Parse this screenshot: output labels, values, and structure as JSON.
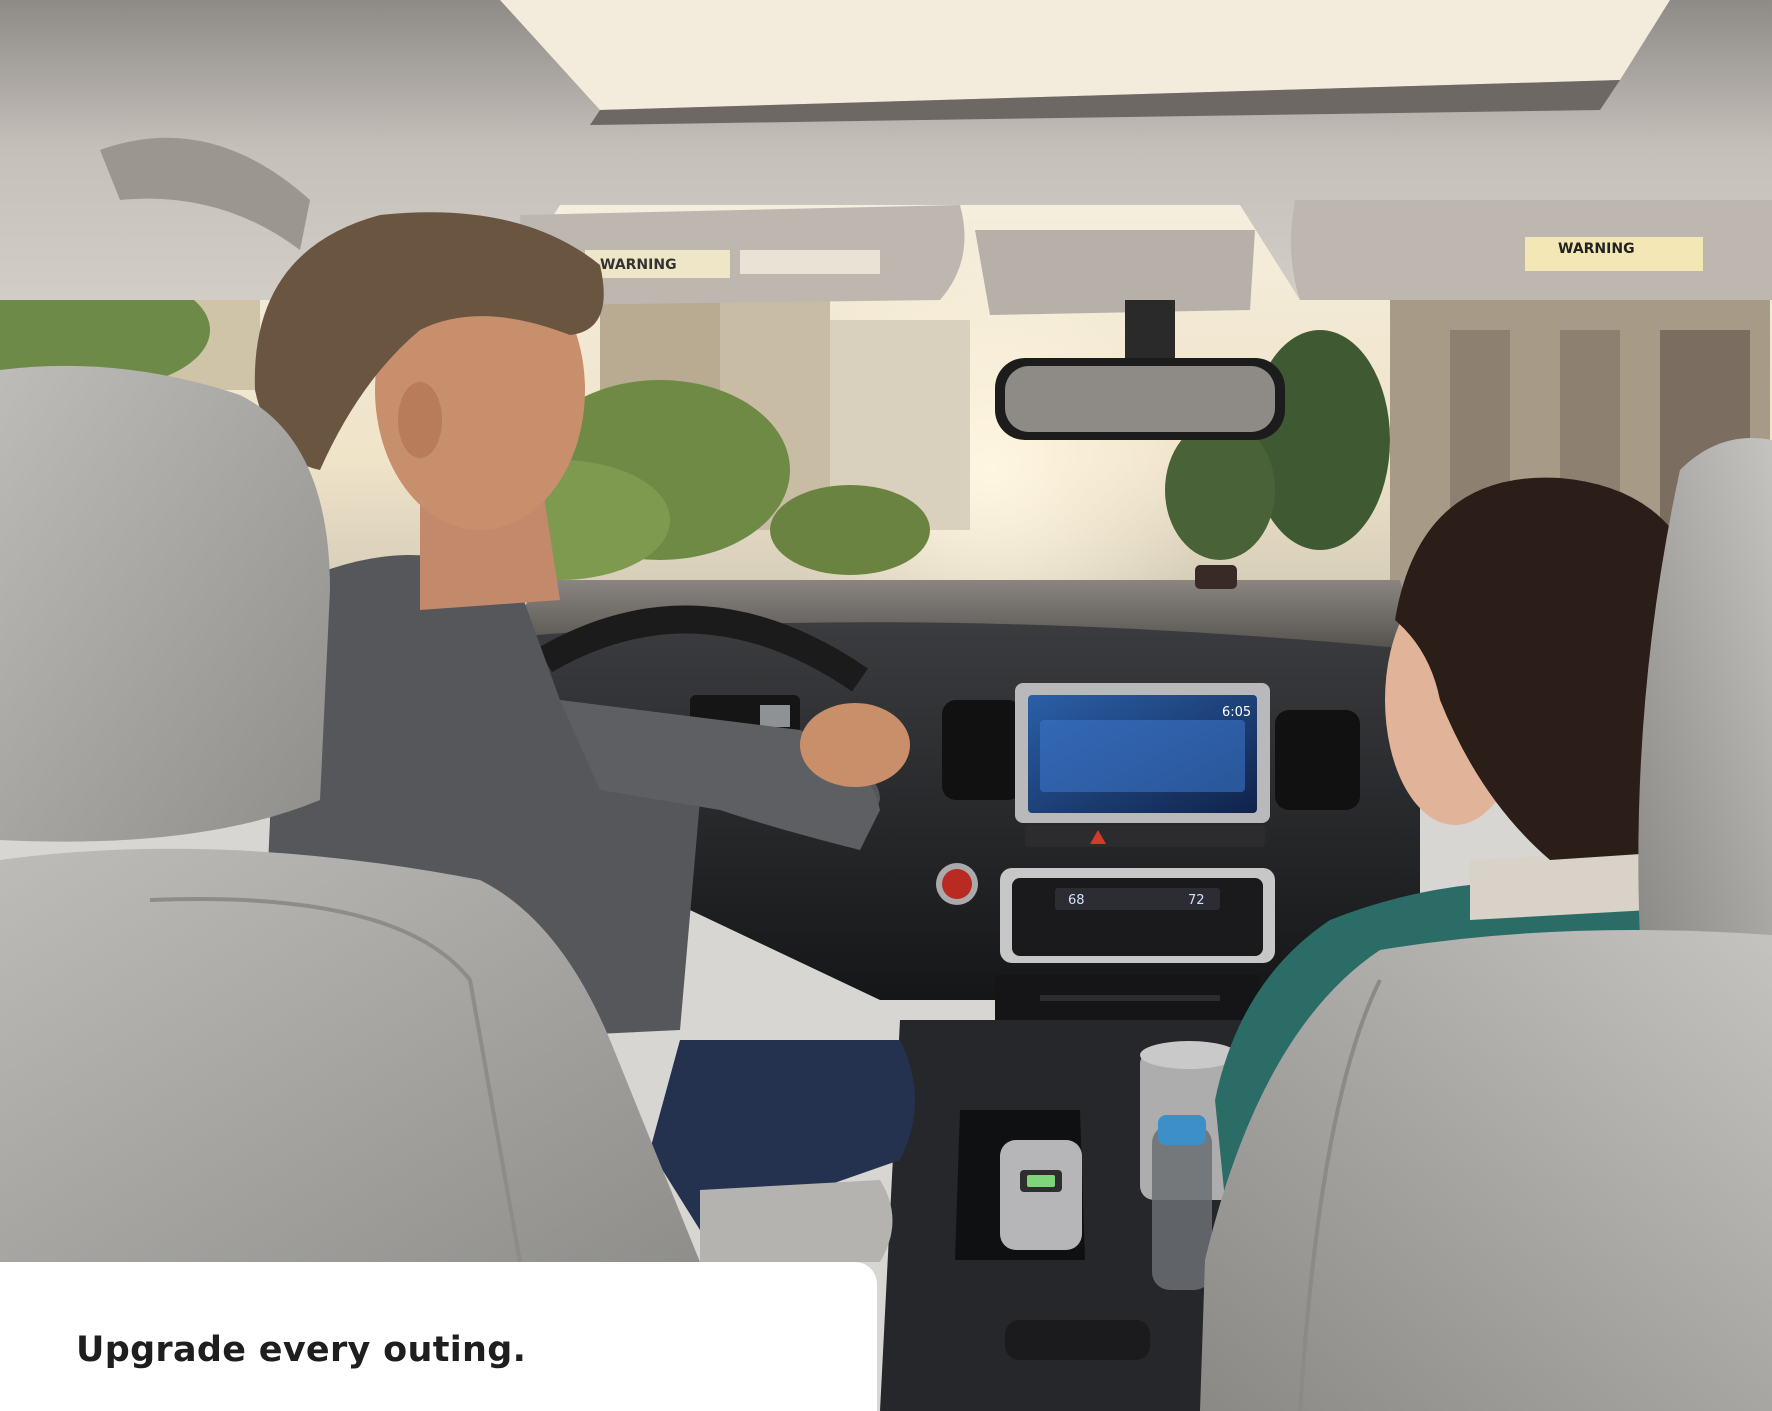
{
  "caption": {
    "text": "Upgrade every outing."
  },
  "visor_labels": {
    "left_warning": "WARNING",
    "right_warning": "WARNING"
  },
  "dashboard": {
    "clock": "6:05",
    "climate_left_temp": "68",
    "climate_right_temp": "72"
  },
  "colors": {
    "headliner": "#c9c4bd",
    "seat_leather": "#a9a8a5",
    "sweater": "#55575a",
    "dash": "#222426",
    "screen_blue": "#3a74c8",
    "sky_glow": "#f3ead8"
  }
}
